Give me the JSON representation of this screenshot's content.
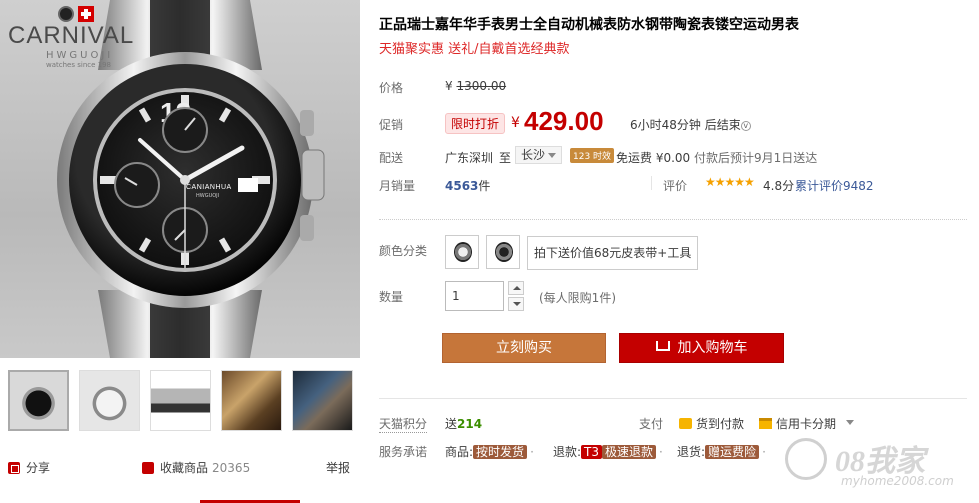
{
  "gallery": {
    "brand_name": "CARNIVAL",
    "brand_sub": "HWGUOJI",
    "brand_tagline": "watches  since  198",
    "dial_brand": "CANIANHUA",
    "dial_sub": "HWGUOJI",
    "thumbnails": [
      "thumb-black-dial",
      "thumb-white-dial",
      "thumb-side-view",
      "thumb-lifestyle-gold",
      "thumb-model-wearing"
    ],
    "share_label": "分享",
    "favorite_label": "收藏商品",
    "favorite_count": "20365",
    "report_label": "举报"
  },
  "product": {
    "title": "正品瑞士嘉年华手表男士全自动机械表防水钢带陶瓷表镂空运动男表",
    "subtitle": "天猫聚实惠 送礼/自戴首选经典款",
    "price_label": "价格",
    "orig_yen": "¥",
    "orig_price": "1300.00",
    "promo_label": "促销",
    "promo_badge": "限时打折",
    "promo_yen": "¥",
    "promo_price": "429.00",
    "countdown": "6小时48分钟 后结束",
    "ship_label": "配送",
    "ship_from": "广东深圳",
    "ship_to": "至",
    "ship_city": "长沙",
    "timely_badge": "123 时效",
    "ship_fee": "免运费 ¥0.00",
    "ship_eta": "付款后预计9月1日送达",
    "sales_label": "月销量",
    "sales_count": "4563",
    "sales_unit": "件",
    "rating_label": "评价",
    "rating_stars": "★★★★★",
    "rating_value": "4.8分",
    "rating_count": "累计评价9482"
  },
  "sku": {
    "color_label": "颜色分类",
    "options": [
      "white-dial-option",
      "black-dial-option"
    ],
    "text_option": "拍下送价值68元皮表带+工具",
    "qty_label": "数量",
    "qty_value": "1",
    "qty_limit": "(每人限购1件)"
  },
  "actions": {
    "buy_now": "立刻购买",
    "add_cart": "加入购物车"
  },
  "extra": {
    "points_label": "天猫积分",
    "points_prefix": "送",
    "points_value": "214",
    "pay_label": "支付",
    "pay_cod": "货到付款",
    "pay_card": "信用卡分期",
    "service_label": "服务承诺",
    "svc1_prefix": "商品:",
    "svc1_tag": "按时发货",
    "svc2_prefix": "退款:",
    "svc2_tag": "T3",
    "svc2_tag_b": "极速退款",
    "svc3_prefix": "退货:",
    "svc3_tag": "赠运费险",
    "sep": "·"
  },
  "watermark": {
    "big": "08我家",
    "small": "myhome2008.com"
  },
  "colors": {
    "accent_red": "#c40000",
    "buy_orange": "#c6763a",
    "link_blue": "#3b5998"
  }
}
